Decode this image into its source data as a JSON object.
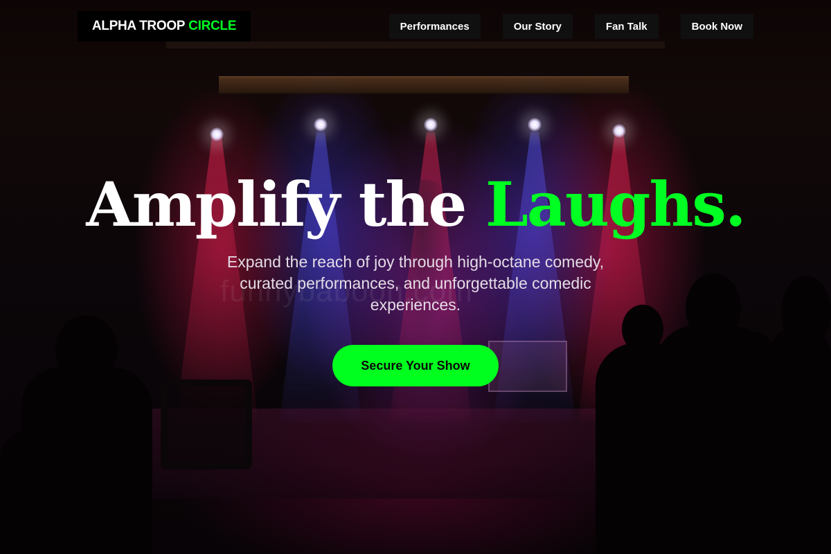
{
  "brand": {
    "name_main": "ALPHA TROOP",
    "name_accent": "CIRCLE",
    "accent_color": "#00ff22"
  },
  "nav": {
    "items": [
      {
        "label": "Performances"
      },
      {
        "label": "Our Story"
      },
      {
        "label": "Fan Talk"
      },
      {
        "label": "Book Now"
      }
    ]
  },
  "hero": {
    "headline_main": "Amplify the",
    "headline_accent": "Laughs.",
    "subtitle": "Expand the reach of joy through high-octane comedy, curated performances, and unforgettable comedic experiences.",
    "cta_label": "Secure Your Show",
    "cta_color": "#00ff1e"
  },
  "background": {
    "watermark": "funnybaboon.com"
  }
}
